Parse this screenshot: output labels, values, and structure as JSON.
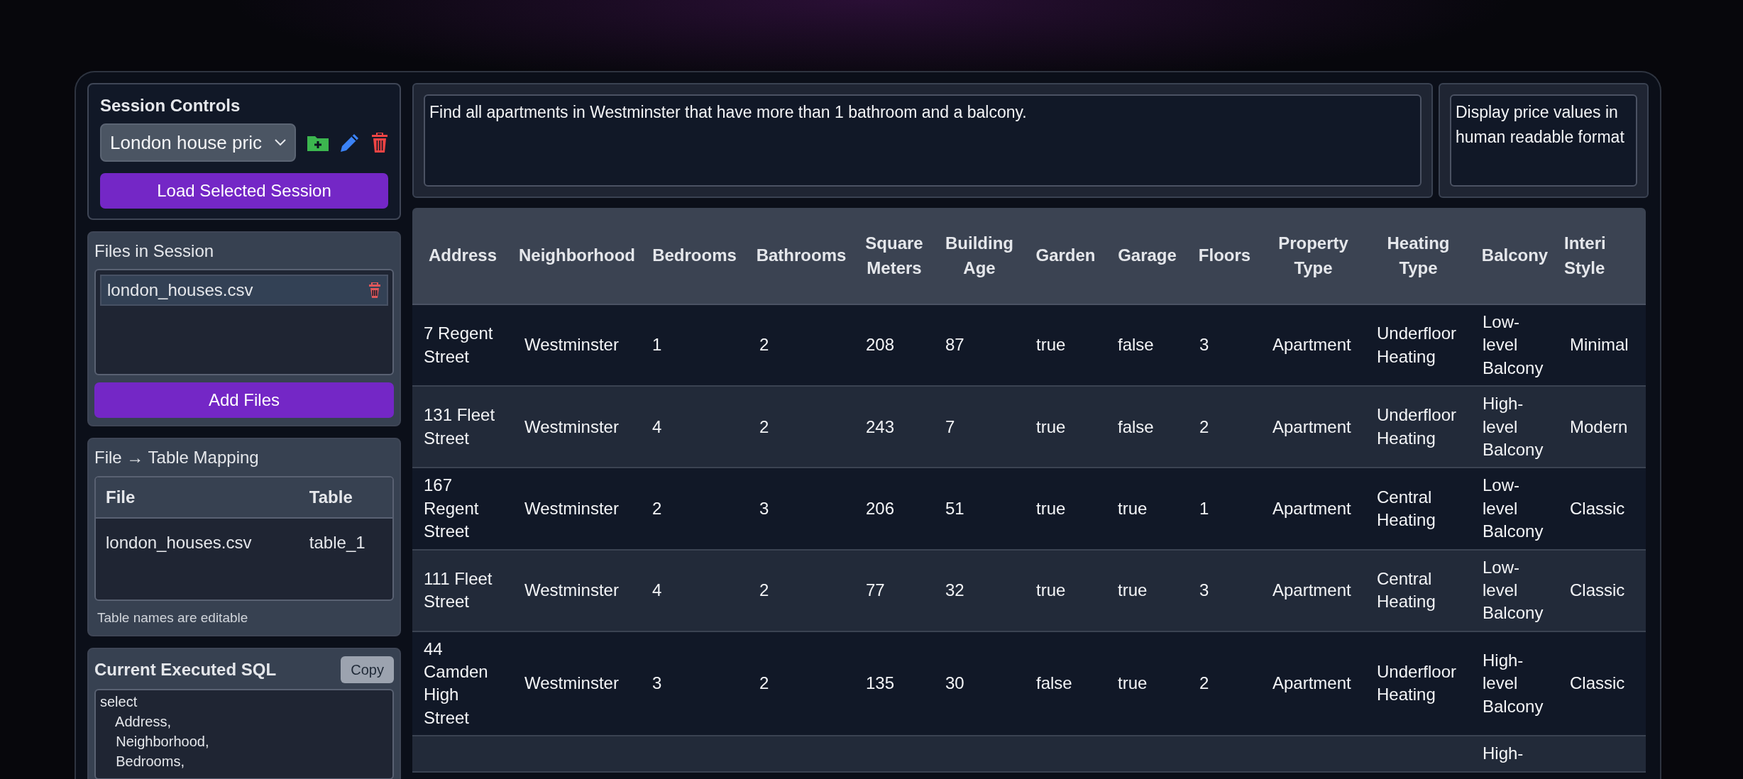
{
  "session_controls": {
    "title": "Session Controls",
    "session_select": {
      "value": "London house pric"
    },
    "load_button": "Load Selected Session"
  },
  "files_in_session": {
    "title": "Files in Session",
    "files": [
      {
        "name": "london_houses.csv"
      }
    ],
    "add_button": "Add Files"
  },
  "file_table_mapping": {
    "title": "File → Table Mapping",
    "columns": [
      "File",
      "Table"
    ],
    "rows": [
      [
        "london_houses.csv",
        "table_1"
      ]
    ],
    "hint": "Table names are editable"
  },
  "executed_sql": {
    "title": "Current Executed SQL",
    "copy_button": "Copy",
    "sql": "select\n    Address,\n    Neighborhood,\n    Bedrooms,"
  },
  "query": {
    "value": "Find all apartments in Westminster that have more than 1 bathroom and a balcony."
  },
  "instructions": {
    "value": "Display price values in human readable format"
  },
  "results_table": {
    "columns": [
      "Address",
      "Neighborhood",
      "Bedrooms",
      "Bathrooms",
      "Square Meters",
      "Building Age",
      "Garden",
      "Garage",
      "Floors",
      "Property Type",
      "Heating Type",
      "Balcony",
      "Interi Style"
    ],
    "rows": [
      [
        "7 Regent Street",
        "Westminster",
        "1",
        "2",
        "208",
        "87",
        "true",
        "false",
        "3",
        "Apartment",
        "Underfloor Heating",
        "Low-level Balcony",
        "Minimal"
      ],
      [
        "131 Fleet Street",
        "Westminster",
        "4",
        "2",
        "243",
        "7",
        "true",
        "false",
        "2",
        "Apartment",
        "Underfloor Heating",
        "High-level Balcony",
        "Modern"
      ],
      [
        "167 Regent Street",
        "Westminster",
        "2",
        "3",
        "206",
        "51",
        "true",
        "true",
        "1",
        "Apartment",
        "Central Heating",
        "Low-level Balcony",
        "Classic"
      ],
      [
        "111 Fleet Street",
        "Westminster",
        "4",
        "2",
        "77",
        "32",
        "true",
        "true",
        "3",
        "Apartment",
        "Central Heating",
        "Low-level Balcony",
        "Classic"
      ],
      [
        "44 Camden High Street",
        "Westminster",
        "3",
        "2",
        "135",
        "30",
        "false",
        "true",
        "2",
        "Apartment",
        "Underfloor Heating",
        "High-level Balcony",
        "Classic"
      ],
      [
        null,
        null,
        null,
        null,
        null,
        null,
        null,
        null,
        null,
        null,
        null,
        "High-",
        null
      ]
    ]
  }
}
